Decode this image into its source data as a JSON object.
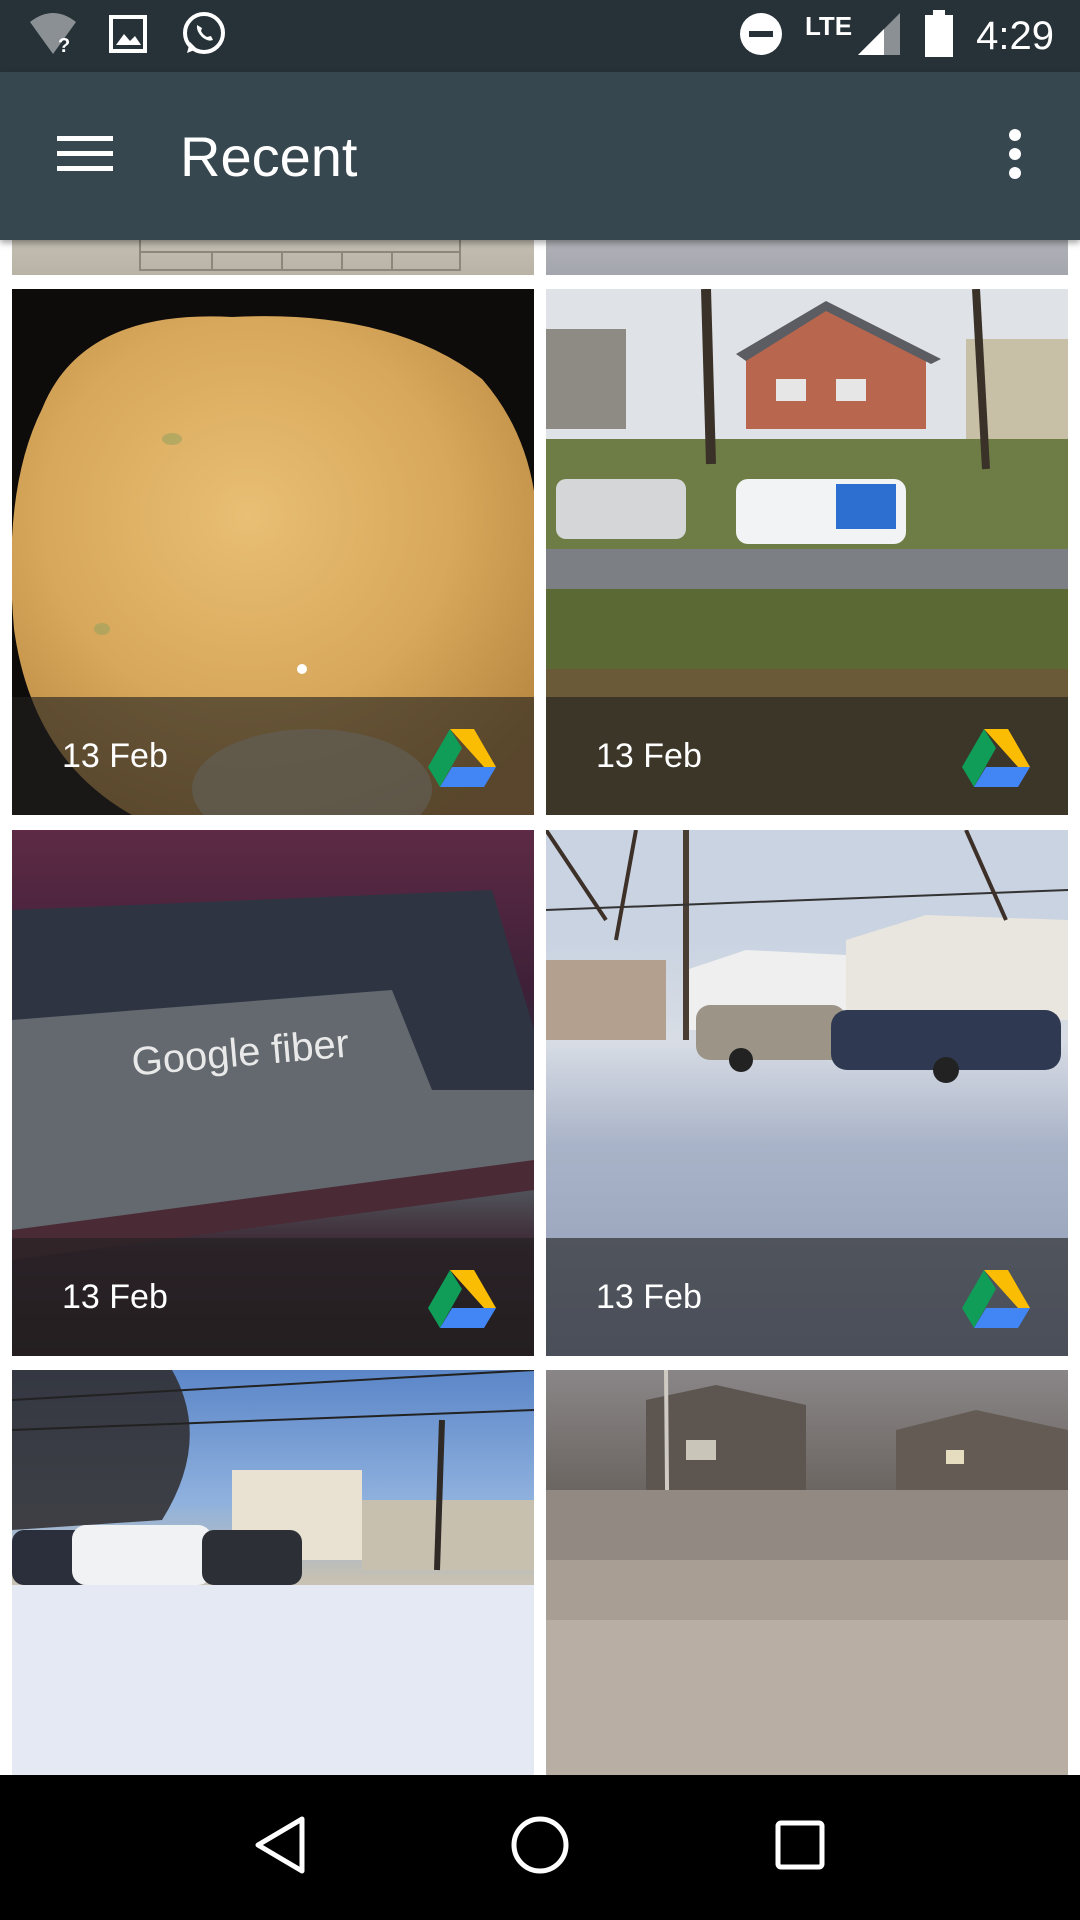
{
  "status_bar": {
    "time": "4:29",
    "network": "LTE",
    "icons": [
      "wifi-unknown-icon",
      "image-notification-icon",
      "whatsapp-icon",
      "do-not-disturb-icon",
      "signal-icon",
      "battery-icon"
    ]
  },
  "app_bar": {
    "title": "Recent",
    "menu_icon": "hamburger-menu-icon",
    "overflow_icon": "more-vert-icon",
    "background": "#37474f"
  },
  "grid": {
    "items": [
      {
        "date": "",
        "source_icon": ""
      },
      {
        "date": "",
        "source_icon": ""
      },
      {
        "date": "13 Feb",
        "source_icon": "google-drive-icon",
        "subject": "pancake"
      },
      {
        "date": "13 Feb",
        "source_icon": "google-drive-icon",
        "subject": "house-street-van"
      },
      {
        "date": "13 Feb",
        "source_icon": "google-drive-icon",
        "subject": "google-fiber-box",
        "photo_text": "Google fiber"
      },
      {
        "date": "13 Feb",
        "source_icon": "google-drive-icon",
        "subject": "snowy-parking-lot"
      },
      {
        "date": "",
        "source_icon": "",
        "subject": "snowy-street-cars"
      },
      {
        "date": "",
        "source_icon": "",
        "subject": "night-street-houses"
      }
    ]
  },
  "nav_bar": {
    "buttons": [
      "back-icon",
      "home-icon",
      "recents-icon"
    ]
  }
}
